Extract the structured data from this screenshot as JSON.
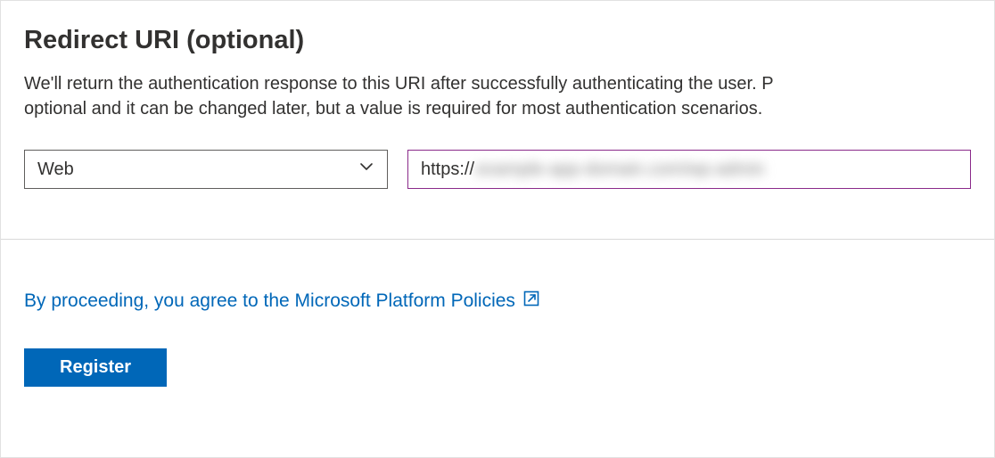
{
  "section": {
    "title": "Redirect URI (optional)",
    "description_line1": "We'll return the authentication response to this URI after successfully authenticating the user. P",
    "description_line2": "optional and it can be changed later, but a value is required for most authentication scenarios."
  },
  "platform_select": {
    "value": "Web"
  },
  "uri_input": {
    "scheme": "https://",
    "rest_placeholder": "example-app-domain.com/wp-admin"
  },
  "footer": {
    "policies_text": "By proceeding, you agree to the Microsoft Platform Policies",
    "register_label": "Register"
  },
  "colors": {
    "primary_blue": "#0067b8",
    "input_focus_border": "#8a2a8a"
  }
}
